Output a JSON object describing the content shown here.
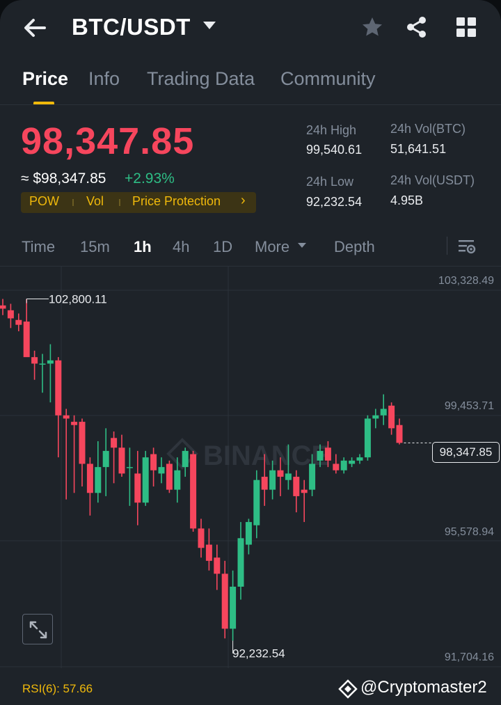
{
  "header": {
    "pair": "BTC/USDT",
    "icons": {
      "back": "arrow-left-icon",
      "favorite": "star-icon",
      "share": "share-icon",
      "menu": "grid-icon"
    }
  },
  "tabs": [
    {
      "label": "Price",
      "active": true
    },
    {
      "label": "Info",
      "active": false
    },
    {
      "label": "Trading Data",
      "active": false
    },
    {
      "label": "Community",
      "active": false
    }
  ],
  "ticker": {
    "last_price": "98,347.85",
    "approx": "≈ $98,347.85",
    "change": "+2.93%",
    "tags": [
      "POW",
      "Vol",
      "Price Protection"
    ],
    "tag_arrow": "›",
    "stats": {
      "high_label": "24h High",
      "high_value": "99,540.61",
      "low_label": "24h Low",
      "low_value": "92,232.54",
      "vol_btc_label": "24h Vol(BTC)",
      "vol_btc_value": "51,641.51",
      "vol_usdt_label": "24h Vol(USDT)",
      "vol_usdt_value": "4.95B"
    }
  },
  "intervals": {
    "items": [
      "Time",
      "15m",
      "1h",
      "4h",
      "1D",
      "More",
      "Depth"
    ],
    "active": "1h"
  },
  "chart": {
    "y_labels": [
      "103,328.49",
      "99,453.71",
      "95,578.94",
      "91,704.16"
    ],
    "high_marker": "102,800.11",
    "low_marker": "92,232.54",
    "current_price": "98,347.85",
    "watermark": "BINANCE",
    "colors": {
      "up": "#2ebd85",
      "down": "#f6465d",
      "grid": "#2b3139"
    }
  },
  "chart_data": {
    "type": "candlestick",
    "interval": "1h",
    "ylim": [
      91704.16,
      103328.49
    ],
    "candles": [
      {
        "o": 102600,
        "h": 102800,
        "l": 102300,
        "c": 102500
      },
      {
        "o": 102450,
        "h": 102650,
        "l": 101900,
        "c": 102200
      },
      {
        "o": 102150,
        "h": 102350,
        "l": 101800,
        "c": 102000
      },
      {
        "o": 102100,
        "h": 102800,
        "l": 101900,
        "c": 101000
      },
      {
        "o": 101000,
        "h": 101200,
        "l": 100300,
        "c": 100800
      },
      {
        "o": 100800,
        "h": 101100,
        "l": 99900,
        "c": 100800
      },
      {
        "o": 100800,
        "h": 101400,
        "l": 99600,
        "c": 100900
      },
      {
        "o": 100900,
        "h": 101000,
        "l": 97900,
        "c": 99200
      },
      {
        "o": 99200,
        "h": 99400,
        "l": 96600,
        "c": 99100
      },
      {
        "o": 99000,
        "h": 99200,
        "l": 96800,
        "c": 98900
      },
      {
        "o": 99000,
        "h": 99100,
        "l": 97000,
        "c": 97700
      },
      {
        "o": 97700,
        "h": 97900,
        "l": 96100,
        "c": 96800
      },
      {
        "o": 96800,
        "h": 98400,
        "l": 96500,
        "c": 97600
      },
      {
        "o": 97600,
        "h": 98800,
        "l": 96700,
        "c": 98100
      },
      {
        "o": 98500,
        "h": 98700,
        "l": 97100,
        "c": 98200
      },
      {
        "o": 98200,
        "h": 98600,
        "l": 97300,
        "c": 97400
      },
      {
        "o": 97600,
        "h": 98200,
        "l": 96400,
        "c": 97600
      },
      {
        "o": 97400,
        "h": 98100,
        "l": 95800,
        "c": 96500
      },
      {
        "o": 96500,
        "h": 98100,
        "l": 96400,
        "c": 97900
      },
      {
        "o": 98000,
        "h": 98200,
        "l": 97000,
        "c": 97500
      },
      {
        "o": 97400,
        "h": 97900,
        "l": 97100,
        "c": 97600
      },
      {
        "o": 97700,
        "h": 97800,
        "l": 96800,
        "c": 96900
      },
      {
        "o": 96900,
        "h": 97900,
        "l": 96500,
        "c": 97500
      },
      {
        "o": 97600,
        "h": 98200,
        "l": 97300,
        "c": 98100
      },
      {
        "o": 98000,
        "h": 98100,
        "l": 95600,
        "c": 95700
      },
      {
        "o": 95700,
        "h": 96000,
        "l": 94800,
        "c": 95100
      },
      {
        "o": 95200,
        "h": 95700,
        "l": 94400,
        "c": 94700
      },
      {
        "o": 94800,
        "h": 95200,
        "l": 93800,
        "c": 94300
      },
      {
        "o": 94300,
        "h": 94700,
        "l": 92300,
        "c": 92600
      },
      {
        "o": 92600,
        "h": 94400,
        "l": 92232,
        "c": 93900
      },
      {
        "o": 93900,
        "h": 95900,
        "l": 93500,
        "c": 95400
      },
      {
        "o": 95200,
        "h": 96000,
        "l": 94900,
        "c": 95900
      },
      {
        "o": 95800,
        "h": 97500,
        "l": 95400,
        "c": 97200
      },
      {
        "o": 97300,
        "h": 98000,
        "l": 96400,
        "c": 96900
      },
      {
        "o": 96900,
        "h": 97800,
        "l": 96600,
        "c": 97500
      },
      {
        "o": 97500,
        "h": 97900,
        "l": 96700,
        "c": 97300
      },
      {
        "o": 97200,
        "h": 98300,
        "l": 96900,
        "c": 97400
      },
      {
        "o": 97300,
        "h": 97500,
        "l": 96200,
        "c": 96700
      },
      {
        "o": 96900,
        "h": 97200,
        "l": 95900,
        "c": 96800
      },
      {
        "o": 96900,
        "h": 98000,
        "l": 96700,
        "c": 97700
      },
      {
        "o": 97800,
        "h": 98300,
        "l": 97600,
        "c": 98100
      },
      {
        "o": 98200,
        "h": 98400,
        "l": 97600,
        "c": 97800
      },
      {
        "o": 97700,
        "h": 98000,
        "l": 97400,
        "c": 97500
      },
      {
        "o": 97500,
        "h": 97900,
        "l": 97400,
        "c": 97800
      },
      {
        "o": 97700,
        "h": 97900,
        "l": 97600,
        "c": 97800
      },
      {
        "o": 97800,
        "h": 98000,
        "l": 97700,
        "c": 97900
      },
      {
        "o": 97900,
        "h": 99200,
        "l": 97800,
        "c": 99100
      },
      {
        "o": 99100,
        "h": 99400,
        "l": 98800,
        "c": 99200
      },
      {
        "o": 99200,
        "h": 99850,
        "l": 98900,
        "c": 99400
      },
      {
        "o": 99500,
        "h": 99600,
        "l": 98600,
        "c": 98800
      },
      {
        "o": 98900,
        "h": 99100,
        "l": 98300,
        "c": 98348
      }
    ]
  },
  "footer": {
    "rsi": "RSI(6): 57.66",
    "watermark_handle": "@Cryptomaster2"
  }
}
